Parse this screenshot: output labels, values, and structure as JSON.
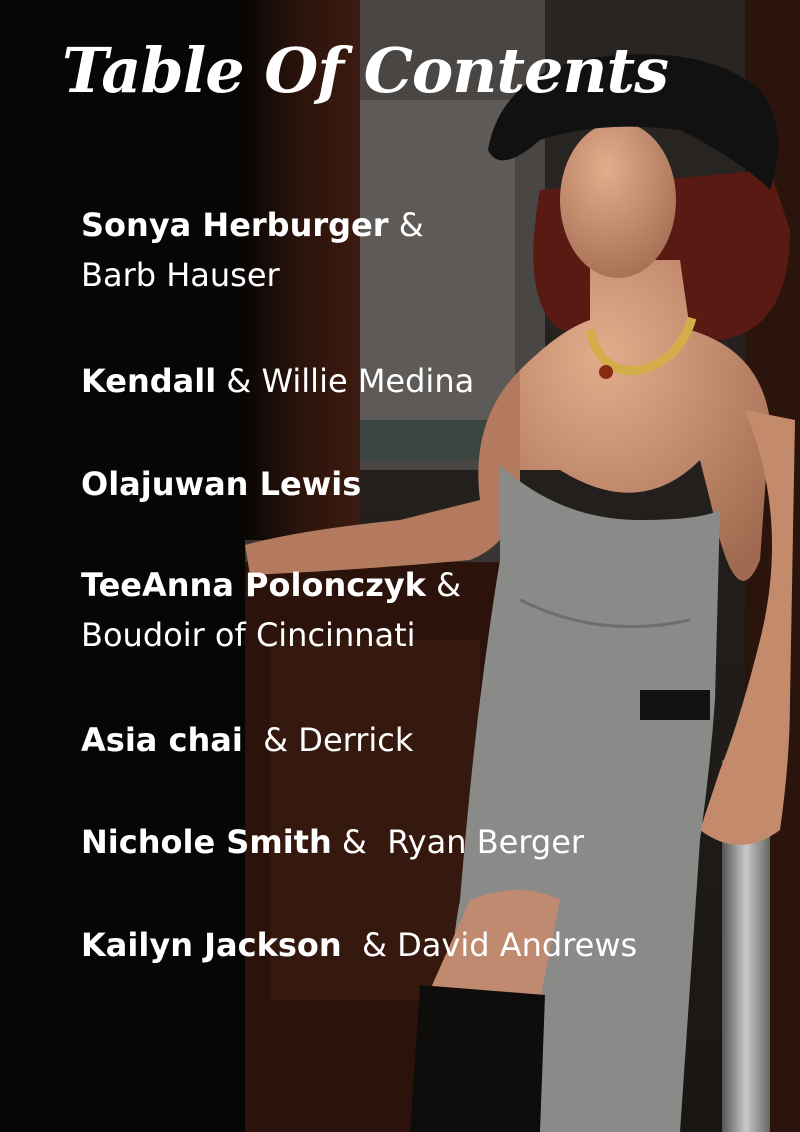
{
  "title": "Table Of Contents",
  "entries": [
    {
      "bold": "Sonya Herburger",
      "rest": " &",
      "line2": "Barb Hauser"
    },
    {
      "bold": "Kendall",
      "rest": " & Willie Medina"
    },
    {
      "bold": "Olajuwan Lewis",
      "rest": ""
    },
    {
      "bold": "TeeAnna Polonczyk",
      "rest": " &",
      "line2": "Boudoir of Cincinnati"
    },
    {
      "bold": "Asia chai",
      "rest": "  & Derrick"
    },
    {
      "bold": "Nichole Smith",
      "rest": " &  Ryan Berger"
    },
    {
      "bold": "Kailyn Jackson",
      "rest": "  & David Andrews"
    }
  ],
  "colors": {
    "text": "#ffffff",
    "left_panel": "#0a0807",
    "wood": "#3a1a10",
    "dress": "#8a8a88",
    "hat": "#111111",
    "skin": "#c98f72",
    "hair": "#5a1a14"
  }
}
